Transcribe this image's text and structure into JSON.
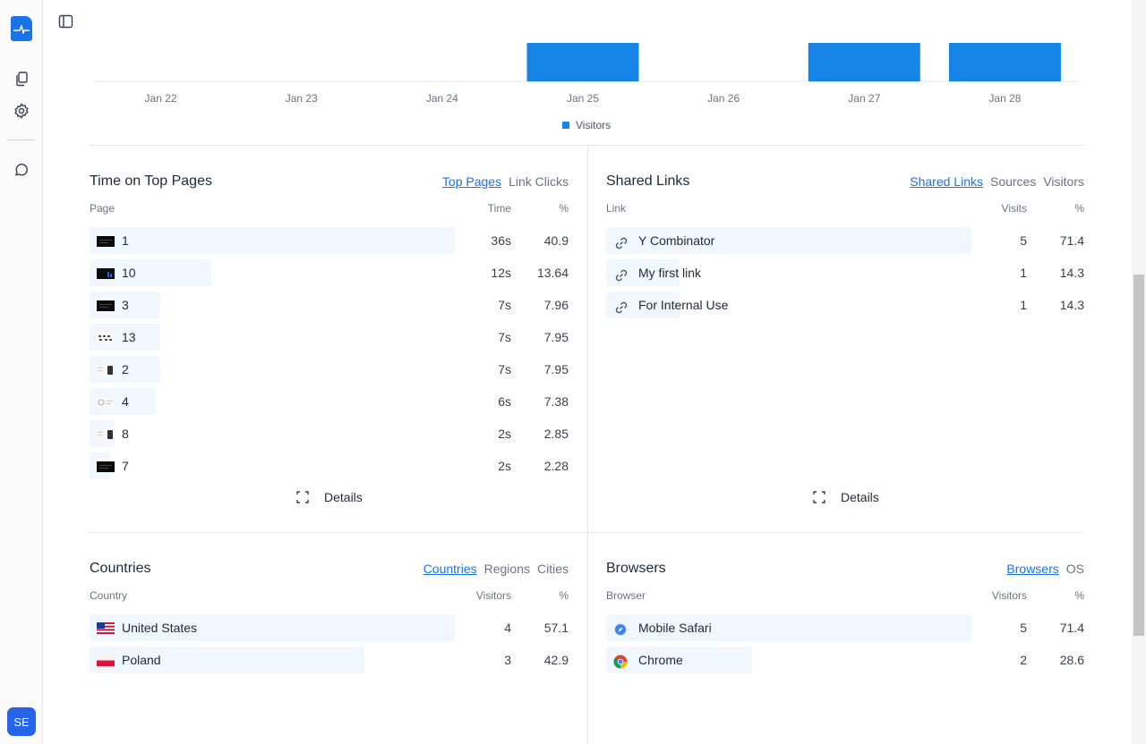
{
  "sidebar": {
    "avatar_initials": "SE",
    "icons": [
      "logo-icon",
      "documents-icon",
      "settings-icon",
      "chat-icon"
    ]
  },
  "colors": {
    "accent": "#1a73e8",
    "bar": "#1584e6",
    "row_bar": "#f0f7fe"
  },
  "chart_data": {
    "type": "bar",
    "categories": [
      "Jan 22",
      "Jan 23",
      "Jan 24",
      "Jan 25",
      "Jan 26",
      "Jan 27",
      "Jan 28"
    ],
    "series": [
      {
        "name": "Visitors",
        "values": [
          0,
          0,
          0,
          1,
          0,
          1,
          1
        ]
      }
    ],
    "note_values_relative": true,
    "legend": "bottom-center",
    "grid": false
  },
  "top_pages": {
    "title": "Time on Top Pages",
    "tabs": [
      "Top Pages",
      "Link Clicks"
    ],
    "active_tab": "Top Pages",
    "columns": {
      "page": "Page",
      "time": "Time",
      "pct": "%"
    },
    "rows": [
      {
        "label": "1",
        "time": "36s",
        "pct": "40.9",
        "share": 0.409,
        "thumb": "dark"
      },
      {
        "label": "10",
        "time": "12s",
        "pct": "13.64",
        "share": 0.1364,
        "thumb": "dark-chart"
      },
      {
        "label": "3",
        "time": "7s",
        "pct": "7.96",
        "share": 0.0796,
        "thumb": "dark"
      },
      {
        "label": "13",
        "time": "7s",
        "pct": "7.95",
        "share": 0.0795,
        "thumb": "dashes"
      },
      {
        "label": "2",
        "time": "7s",
        "pct": "7.95",
        "share": 0.0795,
        "thumb": "light-phone"
      },
      {
        "label": "4",
        "time": "6s",
        "pct": "7.38",
        "share": 0.0738,
        "thumb": "light"
      },
      {
        "label": "8",
        "time": "2s",
        "pct": "2.85",
        "share": 0.0285,
        "thumb": "light-phone"
      },
      {
        "label": "7",
        "time": "2s",
        "pct": "2.28",
        "share": 0.0228,
        "thumb": "dark"
      }
    ],
    "details_label": "Details"
  },
  "shared_links": {
    "title": "Shared Links",
    "tabs": [
      "Shared Links",
      "Sources",
      "Visitors"
    ],
    "active_tab": "Shared Links",
    "columns": {
      "link": "Link",
      "visits": "Visits",
      "pct": "%"
    },
    "rows": [
      {
        "label": "Y Combinator",
        "visits": "5",
        "pct": "71.4",
        "share": 0.714
      },
      {
        "label": "My first link",
        "visits": "1",
        "pct": "14.3",
        "share": 0.143
      },
      {
        "label": "For Internal Use",
        "visits": "1",
        "pct": "14.3",
        "share": 0.143
      }
    ],
    "details_label": "Details"
  },
  "countries": {
    "title": "Countries",
    "tabs": [
      "Countries",
      "Regions",
      "Cities"
    ],
    "active_tab": "Countries",
    "columns": {
      "country": "Country",
      "visitors": "Visitors",
      "pct": "%"
    },
    "rows": [
      {
        "label": "United States",
        "visitors": "4",
        "pct": "57.1",
        "share": 0.571,
        "flag": "us-flag-icon"
      },
      {
        "label": "Poland",
        "visitors": "3",
        "pct": "42.9",
        "share": 0.429,
        "flag": "poland-flag-icon"
      }
    ]
  },
  "browsers": {
    "title": "Browsers",
    "tabs": [
      "Browsers",
      "OS"
    ],
    "active_tab": "Browsers",
    "columns": {
      "browser": "Browser",
      "visitors": "Visitors",
      "pct": "%"
    },
    "rows": [
      {
        "label": "Mobile Safari",
        "visitors": "5",
        "pct": "71.4",
        "share": 0.714,
        "icon": "safari-icon"
      },
      {
        "label": "Chrome",
        "visitors": "2",
        "pct": "28.6",
        "share": 0.286,
        "icon": "chrome-icon"
      }
    ]
  }
}
